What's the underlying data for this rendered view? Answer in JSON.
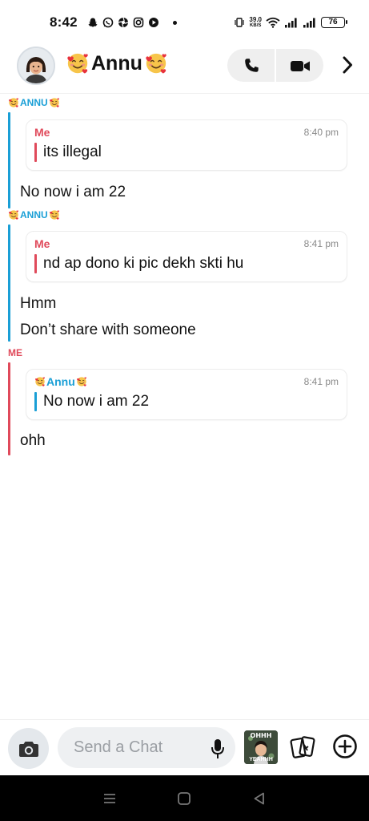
{
  "status_bar": {
    "time": "8:42",
    "net_speed_value": "39.0",
    "net_speed_unit": "KB/S",
    "battery": "76"
  },
  "header": {
    "contact_name": "Annu",
    "icons": [
      "avatar",
      "smiling-face-with-hearts-emoji",
      "phone-icon",
      "video-camera-icon",
      "chevron-right-icon"
    ]
  },
  "messages": [
    {
      "sender": "ANNU",
      "quote": {
        "sender": "Me",
        "time": "8:40 pm",
        "text": "its illegal"
      },
      "lines": [
        "No now i am 22"
      ]
    },
    {
      "sender": "ANNU",
      "quote": {
        "sender": "Me",
        "time": "8:41 pm",
        "text": "nd ap dono ki pic dekh skti hu"
      },
      "lines": [
        "Hmm",
        "Don’t share with someone"
      ]
    },
    {
      "sender": "ME",
      "quote": {
        "sender": "Annu",
        "time": "8:41 pm",
        "text": "No now i am 22"
      },
      "lines": [
        "ohh"
      ]
    }
  ],
  "input_bar": {
    "placeholder": "Send a Chat",
    "sticker_top": "OHHH",
    "sticker_bottom": "YEAHHH"
  },
  "colors": {
    "friend_accent": "#1a9fd6",
    "me_accent": "#e04a5b"
  }
}
